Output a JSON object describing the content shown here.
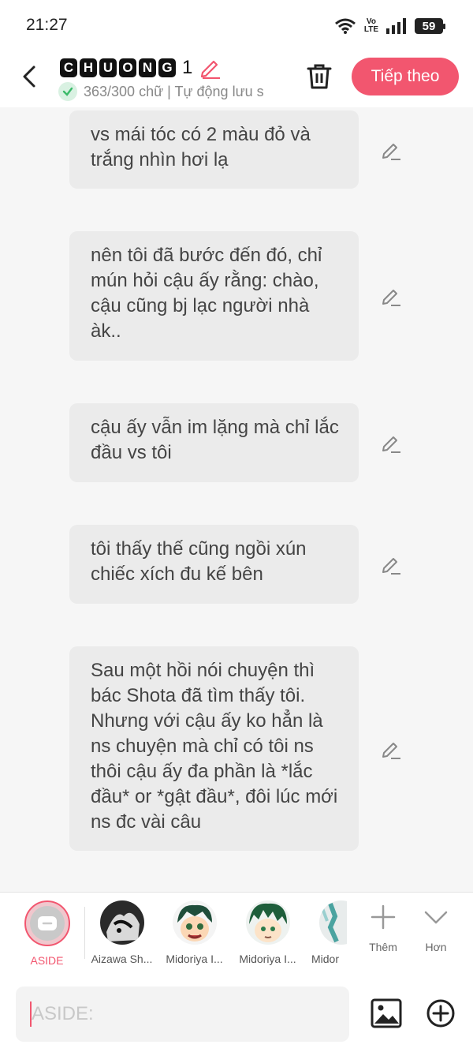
{
  "status_bar": {
    "time": "21:27",
    "network_top": "Vo",
    "network_bottom": "LTE",
    "battery": "59"
  },
  "header": {
    "title_letters": [
      "C",
      "H",
      "U",
      "O",
      "N",
      "G"
    ],
    "title_number": "1",
    "subtitle": "363/300 chữ | Tự động lưu s",
    "next_button": "Tiếp theo"
  },
  "messages": [
    {
      "text": "vs mái tóc có 2 màu đỏ và trắng nhìn hơi lạ"
    },
    {
      "text": "nên tôi đã bước đến đó, chỉ mún hỏi cậu ấy rằng: chào, cậu cũng bj lạc người nhà àk.."
    },
    {
      "text": "cậu ấy vẫn im lặng mà chỉ lắc đầu vs tôi"
    },
    {
      "text": "tôi thấy thế cũng ngồi xún chiếc xích đu kế bên"
    },
    {
      "text": "Sau một hồi nói chuyện thì bác Shota đã tìm thấy tôi. Nhưng với cậu ấy ko hẳn là ns chuyện mà chỉ có tôi ns thôi cậu ấy đa phần là *lắc đầu* or *gật đầu*, đôi lúc mới ns đc vài câu"
    }
  ],
  "characters": [
    {
      "label": "ASIDE"
    },
    {
      "label": "Aizawa Sh..."
    },
    {
      "label": "Midoriya I..."
    },
    {
      "label": "Midoriya I..."
    },
    {
      "label": "Midor"
    }
  ],
  "tools": {
    "more_label": "Thêm",
    "less_label": "Hơn"
  },
  "input": {
    "placeholder": "ASIDE:"
  },
  "colors": {
    "accent": "#f2566f",
    "bubble": "#ebebeb",
    "background": "#f6f6f6"
  }
}
